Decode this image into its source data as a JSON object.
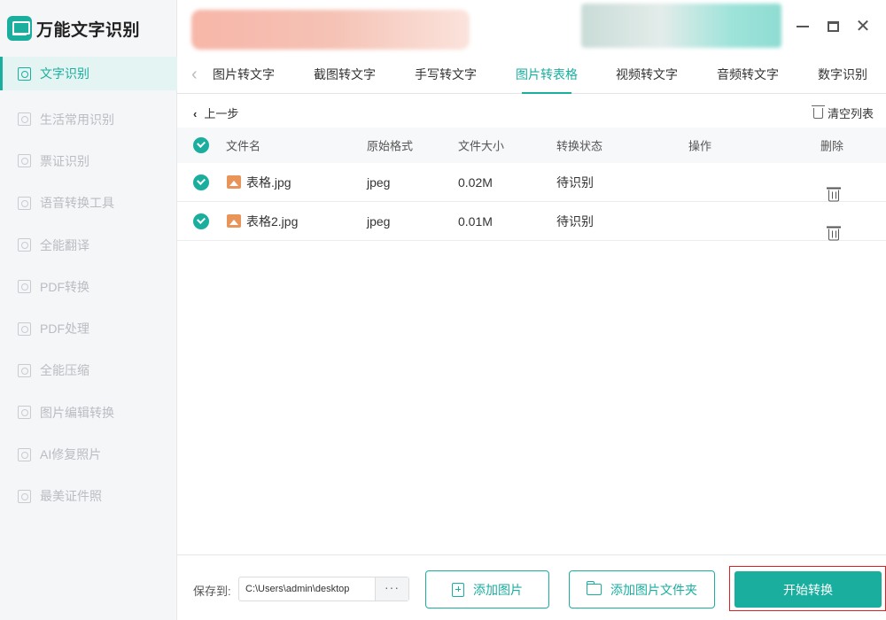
{
  "app": {
    "title": "万能文字识别"
  },
  "sidebar": {
    "items": [
      {
        "label": "文字识别",
        "icon": "ocr-scan-icon"
      },
      {
        "label": "生活常用识别",
        "icon": "scan-icon"
      },
      {
        "label": "票证识别",
        "icon": "ticket-scan-icon"
      },
      {
        "label": "语音转换工具",
        "icon": "voice-icon"
      },
      {
        "label": "全能翻译",
        "icon": "translate-icon"
      },
      {
        "label": "PDF转换",
        "icon": "pdf-convert-icon"
      },
      {
        "label": "PDF处理",
        "icon": "pdf-process-icon"
      },
      {
        "label": "全能压缩",
        "icon": "compress-icon"
      },
      {
        "label": "图片编辑转换",
        "icon": "image-edit-icon"
      },
      {
        "label": "AI修复照片",
        "icon": "ai-repair-icon"
      },
      {
        "label": "最美证件照",
        "icon": "id-photo-icon"
      }
    ]
  },
  "tabs": [
    {
      "label": "图片转文字"
    },
    {
      "label": "截图转文字"
    },
    {
      "label": "手写转文字"
    },
    {
      "label": "图片转表格"
    },
    {
      "label": "视频转文字"
    },
    {
      "label": "音频转文字"
    },
    {
      "label": "数字识别"
    }
  ],
  "toolbar": {
    "back_label": "上一步",
    "clear_label": "清空列表"
  },
  "table": {
    "headers": {
      "name": "文件名",
      "format": "原始格式",
      "size": "文件大小",
      "status": "转换状态",
      "action": "操作",
      "delete": "删除"
    },
    "rows": [
      {
        "name": "表格.jpg",
        "format": "jpeg",
        "size": "0.02M",
        "status": "待识别"
      },
      {
        "name": "表格2.jpg",
        "format": "jpeg",
        "size": "0.01M",
        "status": "待识别"
      }
    ]
  },
  "footer": {
    "save_label": "保存到:",
    "save_path": "C:\\Users\\admin\\desktop",
    "more_label": "···",
    "add_image_label": "添加图片",
    "add_folder_label": "添加图片文件夹",
    "start_label": "开始转换"
  },
  "colors": {
    "accent": "#1aae9f",
    "highlight_frame": "#e02020",
    "file_icon": "#e9955a"
  }
}
